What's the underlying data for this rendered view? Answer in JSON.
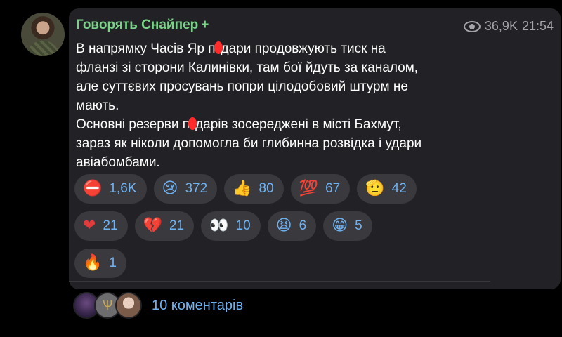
{
  "channel": {
    "name": "Говорять Снайпер",
    "badge": "+"
  },
  "meta": {
    "views": "36,9K",
    "time": "21:54"
  },
  "message": {
    "lines": [
      [
        "В напрямку Часів Яр п",
        "дари продовжують тиск на"
      ],
      [
        "фланзі зі сторони Калинівки, там бої йдуть за каналом,"
      ],
      [
        "але суттєвих просувань попри цілодобовий штурм не"
      ],
      [
        "мають."
      ],
      [
        "Основні резерви п",
        "дарів зосереджені в місті Бахмут,"
      ],
      [
        "зараз як ніколи допомогла би глибинна розвідка і удари"
      ],
      [
        "авіабомбами."
      ]
    ]
  },
  "reactions": [
    {
      "icon": "no-russia-icon",
      "emoji": "⛔",
      "count": "1,6K"
    },
    {
      "icon": "crying-face-icon",
      "emoji": "😢",
      "count": "372"
    },
    {
      "icon": "thumbs-up-icon",
      "emoji": "👍",
      "count": "80"
    },
    {
      "icon": "hundred-points-icon",
      "emoji": "💯",
      "count": "67"
    },
    {
      "icon": "salute-hand-icon",
      "emoji": "🫡",
      "count": "42"
    },
    {
      "icon": "red-heart-icon",
      "emoji": "❤",
      "count": "21"
    },
    {
      "icon": "broken-heart-icon",
      "emoji": "💔",
      "count": "21"
    },
    {
      "icon": "eyes-icon",
      "emoji": "👀",
      "count": "10"
    },
    {
      "icon": "exploding-face-icon",
      "emoji": "😫",
      "count": "6"
    },
    {
      "icon": "grinning-face-icon",
      "emoji": "😁",
      "count": "5"
    },
    {
      "icon": "fire-icon",
      "emoji": "🔥",
      "count": "1"
    }
  ],
  "comments": {
    "label": "10 коментарів"
  },
  "colors": {
    "name": "#7bd38a",
    "accent": "#6fb2f2",
    "bubble": "#222226",
    "pill": "#3a3a3e"
  }
}
